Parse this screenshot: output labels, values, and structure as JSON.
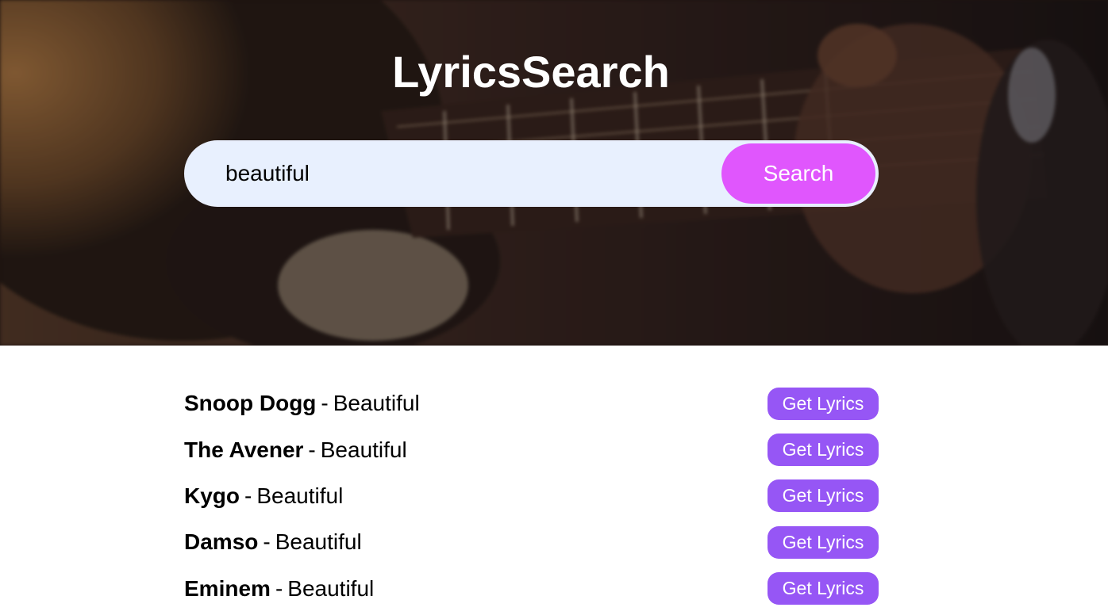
{
  "header": {
    "title": "LyricsSearch"
  },
  "search": {
    "value": "beautiful",
    "button_label": "Search"
  },
  "results": [
    {
      "artist": "Snoop Dogg",
      "separator": "-",
      "title": "Beautiful",
      "button_label": "Get Lyrics"
    },
    {
      "artist": "The Avener",
      "separator": "-",
      "title": "Beautiful",
      "button_label": "Get Lyrics"
    },
    {
      "artist": "Kygo",
      "separator": "-",
      "title": "Beautiful",
      "button_label": "Get Lyrics"
    },
    {
      "artist": "Damso",
      "separator": "-",
      "title": "Beautiful",
      "button_label": "Get Lyrics"
    },
    {
      "artist": "Eminem",
      "separator": "-",
      "title": "Beautiful",
      "button_label": "Get Lyrics"
    }
  ],
  "colors": {
    "search_button": "#e056fd",
    "get_lyrics_button": "#9656f5",
    "search_bar_bg": "#e8f0fe"
  }
}
